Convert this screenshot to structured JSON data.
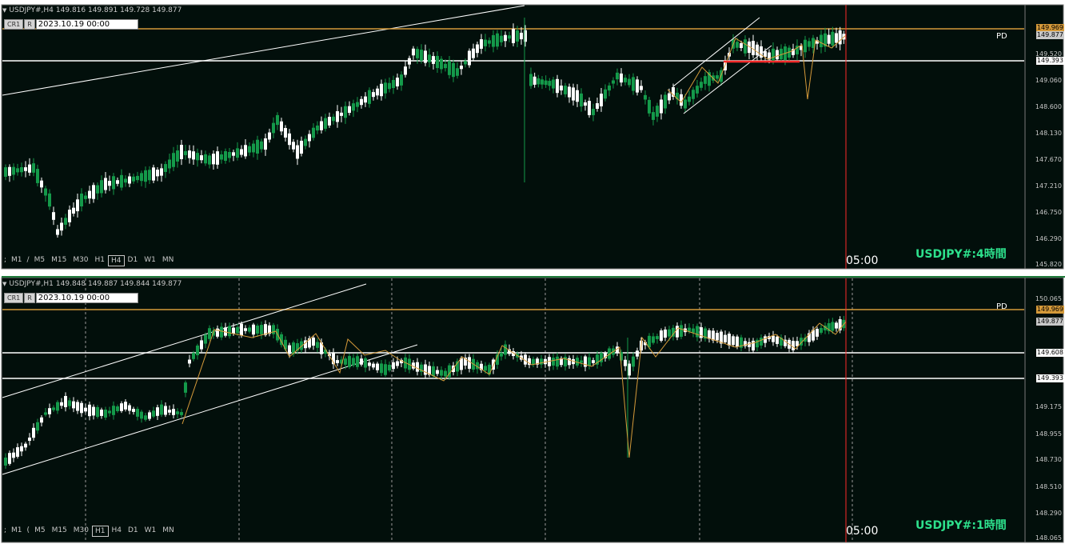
{
  "colors": {
    "background": "#020f0b",
    "bull": "#149a4a",
    "bear": "#ffffff",
    "pd_line": "#d59a3a",
    "hline": "#ffffff",
    "red": "#ff2a2a",
    "label_green": "#2de08c"
  },
  "win1": {
    "symbol_info": "USDJPY#,H4",
    "ohlc": "149.816 149.891 149.728 149.877",
    "btn_cr1": "CR1",
    "btn_r": "R",
    "date": "2023.10.19 00:00",
    "pd": "PD",
    "big_label": "USDJPY#:4時間",
    "time_label": "05:00",
    "timeframes": [
      ";",
      "M1",
      "/",
      "M5",
      "M15",
      "M30",
      "H1",
      "H4",
      "D1",
      "W1",
      "MN"
    ],
    "active_tf": "H4",
    "axis_labels": [
      "149.520",
      "149.060",
      "148.600",
      "148.130",
      "147.670",
      "147.210",
      "146.750",
      "146.290",
      "145.820"
    ],
    "price_tags": {
      "pd": "149.969",
      "current": "149.877",
      "level": "149.393"
    }
  },
  "win2": {
    "symbol_info": "USDJPY#,H1",
    "ohlc": "149.848 149.887 149.844 149.877",
    "btn_cr1": "CR1",
    "btn_r": "R",
    "date": "2023.10.19 00:00",
    "pd": "PD",
    "big_label": "USDJPY#:1時間",
    "time_label": "05:00",
    "timeframes": [
      ";",
      "M1",
      "(",
      "M5",
      "M15",
      "M30",
      "H1",
      "H4",
      "D1",
      "W1",
      "MN"
    ],
    "active_tf": "H1",
    "axis_labels": [
      "150.065",
      "149.175",
      "148.955",
      "148.730",
      "148.510",
      "148.290",
      "148.065"
    ],
    "price_tags": {
      "pd": "149.969",
      "current": "149.877",
      "level1": "149.608",
      "level2": "149.393"
    }
  }
}
